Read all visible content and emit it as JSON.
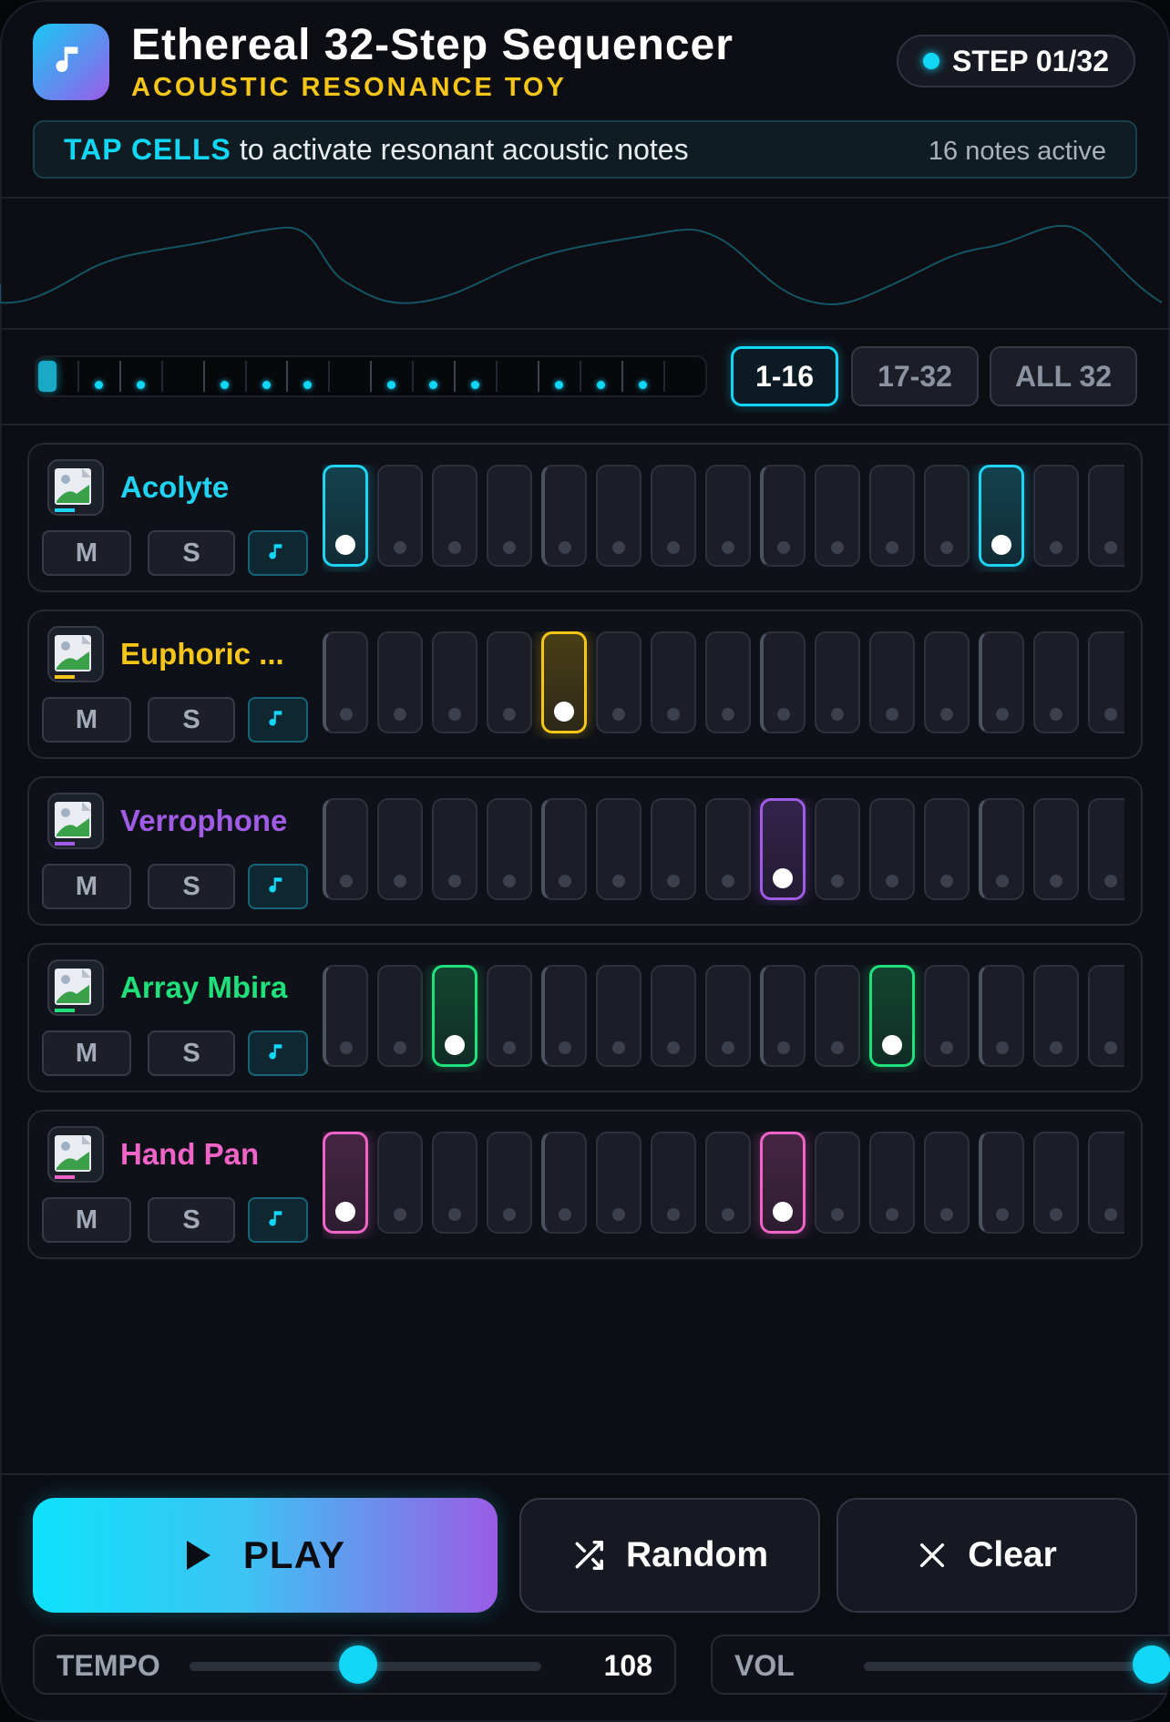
{
  "app": {
    "title": "Ethereal 32-Step Sequencer",
    "subtitle": "ACOUSTIC RESONANCE TOY",
    "icon": "music-note-icon",
    "step_indicator": "STEP 01/32"
  },
  "hint": {
    "strong": "TAP CELLS",
    "text": "to activate resonant acoustic notes",
    "count": "16 notes active"
  },
  "overview": {
    "active_steps": [
      2,
      3,
      5,
      6,
      7,
      9,
      10,
      11,
      13,
      14,
      15
    ]
  },
  "pages": [
    {
      "label": "1-16",
      "active": true
    },
    {
      "label": "17-32",
      "active": false
    },
    {
      "label": "ALL 32",
      "active": false
    }
  ],
  "tracks": [
    {
      "name": "Acolyte",
      "color": "#1fd3f2",
      "mute_label": "M",
      "solo_label": "S",
      "icon": "image-placeholder-icon",
      "active_steps": [
        1,
        13
      ]
    },
    {
      "name": "Euphoric ...",
      "color": "#f5c518",
      "mute_label": "M",
      "solo_label": "S",
      "icon": "image-placeholder-icon",
      "active_steps": [
        5
      ]
    },
    {
      "name": "Verrophone",
      "color": "#a15ce6",
      "mute_label": "M",
      "solo_label": "S",
      "icon": "image-placeholder-icon",
      "active_steps": [
        9
      ]
    },
    {
      "name": "Array Mbira",
      "color": "#1fe07a",
      "mute_label": "M",
      "solo_label": "S",
      "icon": "image-placeholder-icon",
      "active_steps": [
        3,
        11
      ]
    },
    {
      "name": "Hand Pan",
      "color": "#f064c8",
      "mute_label": "M",
      "solo_label": "S",
      "icon": "image-placeholder-icon",
      "active_steps": [
        1,
        9
      ]
    }
  ],
  "controls": {
    "play_label": "PLAY",
    "random_label": "Random",
    "clear_label": "Clear",
    "tempo_label": "TEMPO",
    "tempo_value": "108",
    "tempo_fraction": 0.48,
    "vol_label": "VOL",
    "vol_fraction": 0.98
  },
  "colors": {
    "accent": "#12d6f5",
    "highlight": "#f5c518"
  }
}
